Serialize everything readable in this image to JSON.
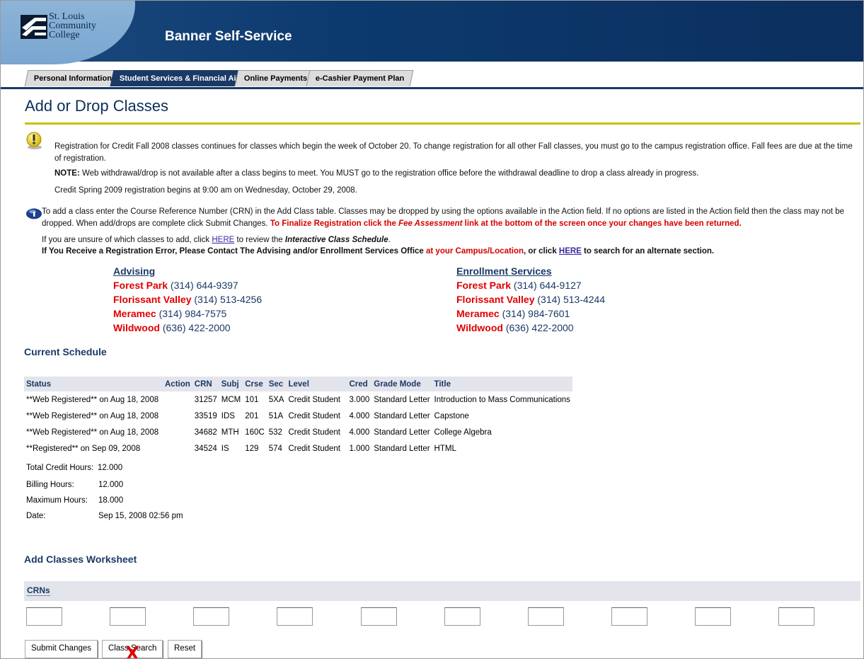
{
  "header": {
    "logo_lines": [
      "St. Louis",
      "Community",
      "College"
    ],
    "app_title": "Banner Self-Service"
  },
  "tabs": [
    {
      "label": "Personal Information",
      "active": false
    },
    {
      "label": "Student Services & Financial Aid",
      "active": true
    },
    {
      "label": "Online Payments",
      "active": false
    },
    {
      "label": "e-Cashier Payment Plan",
      "active": false
    }
  ],
  "page": {
    "title": "Add or Drop Classes"
  },
  "notices": {
    "warning_icon": "exclamation-icon",
    "line1": "Registration for Credit Fall 2008 classes continues for classes which begin the week of October 20. To change registration for all other Fall classes, you must go to the campus registration office. Fall fees are due at the time of registration.",
    "note_label": "NOTE:",
    "note_text": " Web withdrawal/drop is not available after a class begins to meet. You MUST go to the registration office before the withdrawal deadline to drop a class already in progress.",
    "line3": "Credit Spring 2009 registration begins at 9:00 am on Wednesday, October 29, 2008.",
    "info_icon": "info-icon",
    "info_text": "To add a class enter the Course Reference Number (CRN) in the Add Class table. Classes may be dropped by using the options available in the Action field. If no options are listed in the Action field then the class may not be dropped. When add/drops are complete click Submit Changes. ",
    "info_red_a": "To Finalize Registration click the ",
    "info_red_em": "Fee Assessment",
    "info_red_b": " link at the bottom of the screen once your changes have been returned.",
    "unsure_a": "If you are unsure of which classes to add, click ",
    "unsure_link": "HERE",
    "unsure_b": " to review the ",
    "unsure_c": "Interactive Class Schedule",
    "unsure_d": ".",
    "error_a": "If You Receive a Registration Error, Please Contact The Advising and/or Enrollment Services Office ",
    "error_red": "at your Campus/Location",
    "error_b": ", or click ",
    "error_link": "HERE",
    "error_c": " to search for an alternate section."
  },
  "contacts": {
    "advising": {
      "heading": "Advising",
      "rows": [
        {
          "loc": "Forest Park",
          "phone": " (314) 644-9397"
        },
        {
          "loc": "Florissant Valley",
          "phone": " (314) 513-4256"
        },
        {
          "loc": "Meramec",
          "phone": " (314) 984-7575"
        },
        {
          "loc": "Wildwood",
          "phone": " (636) 422-2000"
        }
      ]
    },
    "enrollment": {
      "heading": "Enrollment Services",
      "rows": [
        {
          "loc": "Forest Park",
          "phone": " (314) 644-9127"
        },
        {
          "loc": "Florissant Valley",
          "phone": " (314) 513-4244"
        },
        {
          "loc": "Meramec",
          "phone": " (314) 984-7601"
        },
        {
          "loc": "Wildwood",
          "phone": " (636) 422-2000"
        }
      ]
    }
  },
  "schedule": {
    "heading": "Current Schedule",
    "columns": [
      "Status",
      "Action",
      "CRN",
      "Subj",
      "Crse",
      "Sec",
      "Level",
      "Cred",
      "Grade Mode",
      "Title"
    ],
    "rows": [
      [
        "**Web Registered** on Aug 18, 2008",
        "",
        "31257",
        "MCM",
        "101",
        "5XA",
        "Credit Student",
        "3.000",
        "Standard Letter",
        "Introduction to Mass Communications"
      ],
      [
        "**Web Registered** on Aug 18, 2008",
        "",
        "33519",
        "IDS",
        "201",
        "51A",
        "Credit Student",
        "4.000",
        "Standard Letter",
        "Capstone"
      ],
      [
        "**Web Registered** on Aug 18, 2008",
        "",
        "34682",
        "MTH",
        "160C",
        "532",
        "Credit Student",
        "4.000",
        "Standard Letter",
        "College Algebra"
      ],
      [
        "**Registered** on Sep 09, 2008",
        "",
        "34524",
        "IS",
        "129",
        "574",
        "Credit Student",
        "1.000",
        "Standard Letter",
        "HTML"
      ]
    ],
    "summary": [
      {
        "label": "Total Credit Hours:",
        "value": "12.000"
      },
      {
        "label": "Billing Hours:",
        "value": "12.000"
      },
      {
        "label": "Maximum Hours:",
        "value": "18.000"
      },
      {
        "label": "Date:",
        "value": "Sep 15, 2008 02:56 pm"
      }
    ]
  },
  "worksheet": {
    "heading": "Add Classes Worksheet",
    "crn_label": "CRNs",
    "crn_values": [
      "",
      "",
      "",
      "",
      "",
      "",
      "",
      "",
      "",
      ""
    ],
    "buttons": {
      "submit": "Submit Changes",
      "search": "Class Search",
      "reset": "Reset"
    },
    "annotation": "X"
  },
  "colors": {
    "navy": "#1a3a66",
    "red": "#e00000",
    "rule": "#c7c200"
  }
}
